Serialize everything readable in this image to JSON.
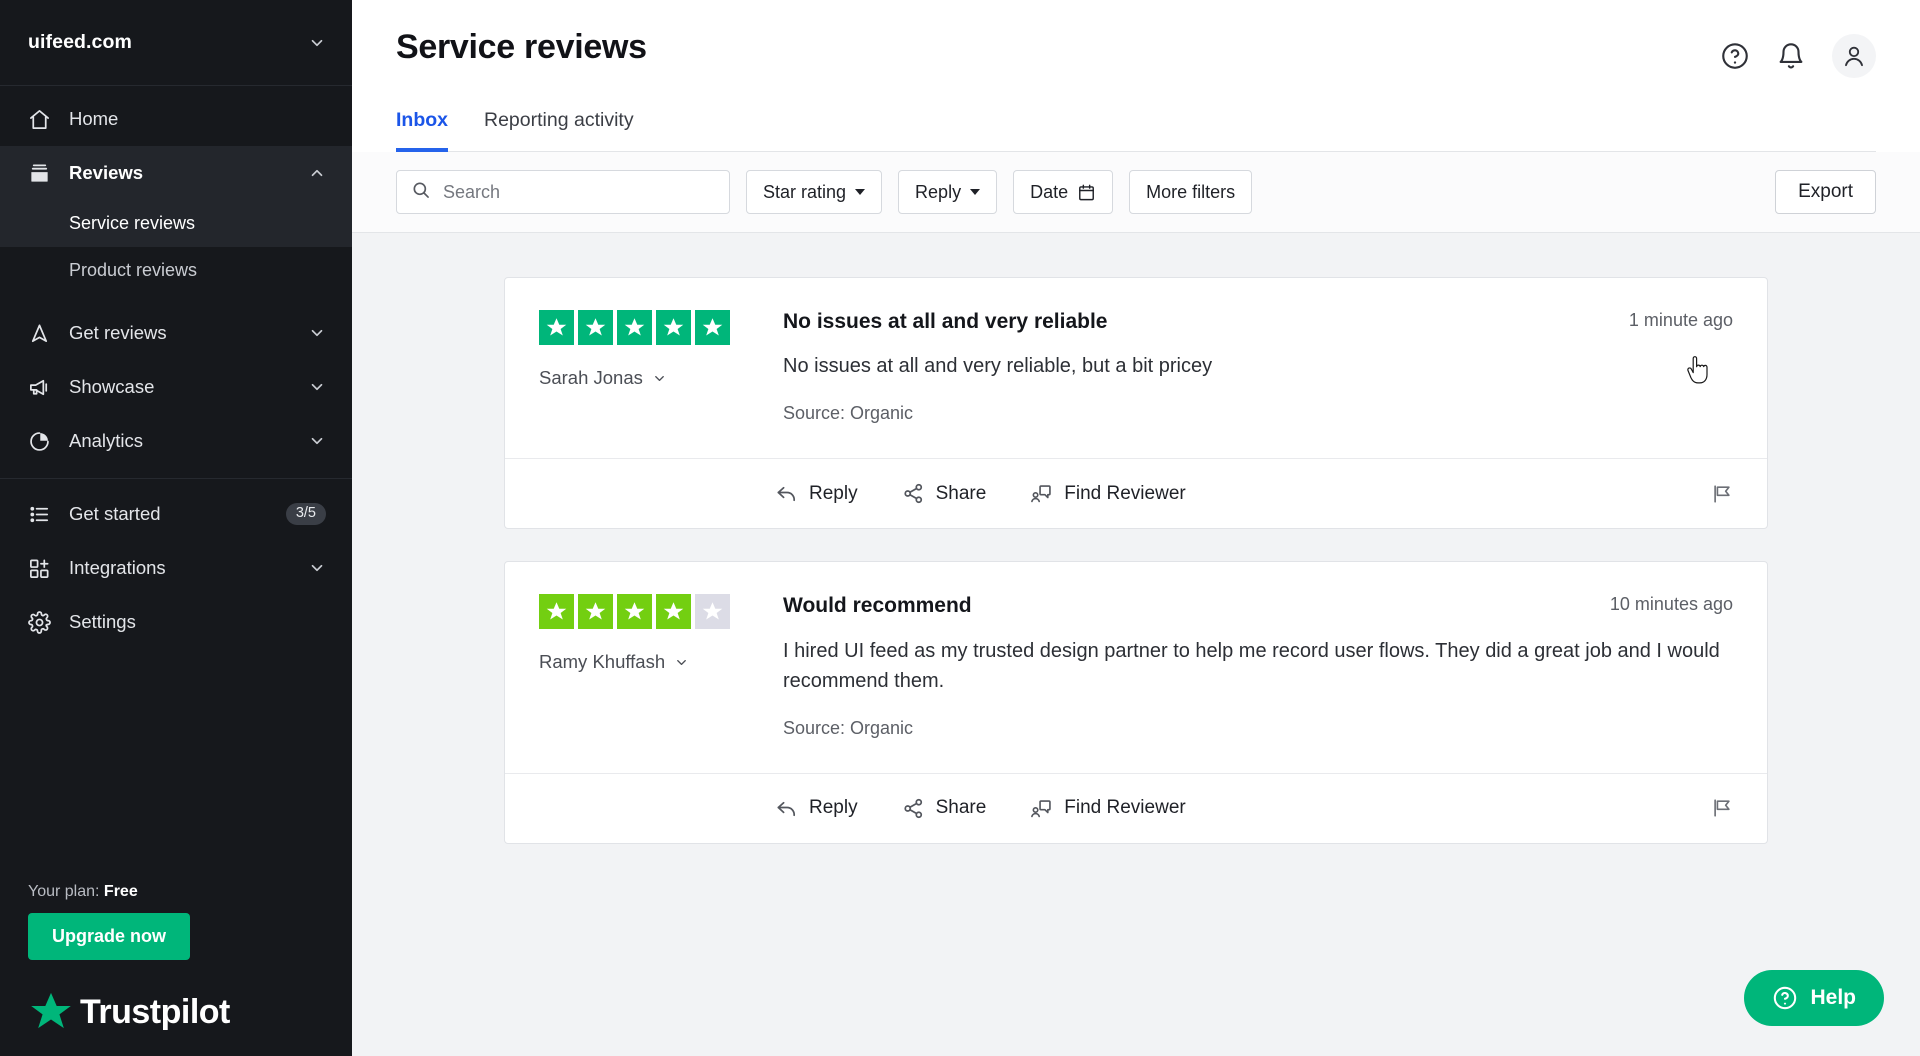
{
  "colors": {
    "brand_green": "#00b67a",
    "star_5": "#00b67a",
    "star_4": "#73cf11",
    "star_empty": "#dcdce6",
    "tab_active": "#1b55e8",
    "sidebar_bg": "#16181c"
  },
  "sidebar": {
    "brand": "uifeed.com",
    "brand_chevron_icon": "chevron-down-icon",
    "items": [
      {
        "label": "Home",
        "icon": "home-icon",
        "expandable": false,
        "active": false
      },
      {
        "label": "Reviews",
        "icon": "inbox-icon",
        "expandable": true,
        "active": true,
        "chevron": "chevron-up-icon"
      },
      {
        "label": "Get reviews",
        "icon": "send-icon",
        "expandable": true,
        "active": false,
        "chevron": "chevron-down-icon"
      },
      {
        "label": "Showcase",
        "icon": "megaphone-icon",
        "expandable": true,
        "active": false,
        "chevron": "chevron-down-icon"
      },
      {
        "label": "Analytics",
        "icon": "pie-chart-icon",
        "expandable": true,
        "active": false,
        "chevron": "chevron-down-icon"
      }
    ],
    "sub_items": [
      {
        "label": "Service reviews",
        "current": true
      },
      {
        "label": "Product reviews",
        "current": false
      }
    ],
    "lower_items": [
      {
        "label": "Get started",
        "icon": "checklist-icon",
        "badge": "3/5",
        "expandable": false
      },
      {
        "label": "Integrations",
        "icon": "grid-plus-icon",
        "badge": "",
        "expandable": true,
        "chevron": "chevron-down-icon"
      },
      {
        "label": "Settings",
        "icon": "gear-icon",
        "badge": "",
        "expandable": false
      }
    ],
    "plan_label": "Your plan:",
    "plan_value": "Free",
    "upgrade_label": "Upgrade now",
    "logo_text": "Trustpilot",
    "logo_icon": "trustpilot-star-icon"
  },
  "header": {
    "title": "Service reviews",
    "icons": [
      {
        "name": "help-circle-icon"
      },
      {
        "name": "bell-icon"
      },
      {
        "name": "user-avatar-icon"
      }
    ]
  },
  "tabs": [
    {
      "label": "Inbox",
      "active": true
    },
    {
      "label": "Reporting activity",
      "active": false
    }
  ],
  "filters": {
    "search_placeholder": "Search",
    "search_value": "",
    "search_icon": "search-icon",
    "star_rating_label": "Star rating",
    "reply_label": "Reply",
    "date_label": "Date",
    "date_icon": "calendar-icon",
    "more_filters_label": "More filters",
    "export_label": "Export"
  },
  "reviews": [
    {
      "stars": 5,
      "star_color": "#00b67a",
      "reviewer": "Sarah Jonas",
      "title": "No issues at all and very reliable",
      "text": "No issues at all and very reliable, but a bit pricey",
      "source": "Source: Organic",
      "time": "1 minute ago",
      "actions": [
        {
          "label": "Reply",
          "icon": "reply-arrow-icon"
        },
        {
          "label": "Share",
          "icon": "share-nodes-icon"
        },
        {
          "label": "Find Reviewer",
          "icon": "find-reviewer-icon"
        }
      ],
      "flag_icon": "flag-icon"
    },
    {
      "stars": 4,
      "star_color": "#73cf11",
      "reviewer": "Ramy Khuffash",
      "title": "Would recommend",
      "text": "I hired UI feed as my trusted design partner to help me record user flows. They did a great job and I would recommend them.",
      "source": "Source: Organic",
      "time": "10 minutes ago",
      "actions": [
        {
          "label": "Reply",
          "icon": "reply-arrow-icon"
        },
        {
          "label": "Share",
          "icon": "share-nodes-icon"
        },
        {
          "label": "Find Reviewer",
          "icon": "find-reviewer-icon"
        }
      ],
      "flag_icon": "flag-icon"
    }
  ],
  "help_widget": {
    "label": "Help",
    "icon": "help-circle-icon"
  }
}
